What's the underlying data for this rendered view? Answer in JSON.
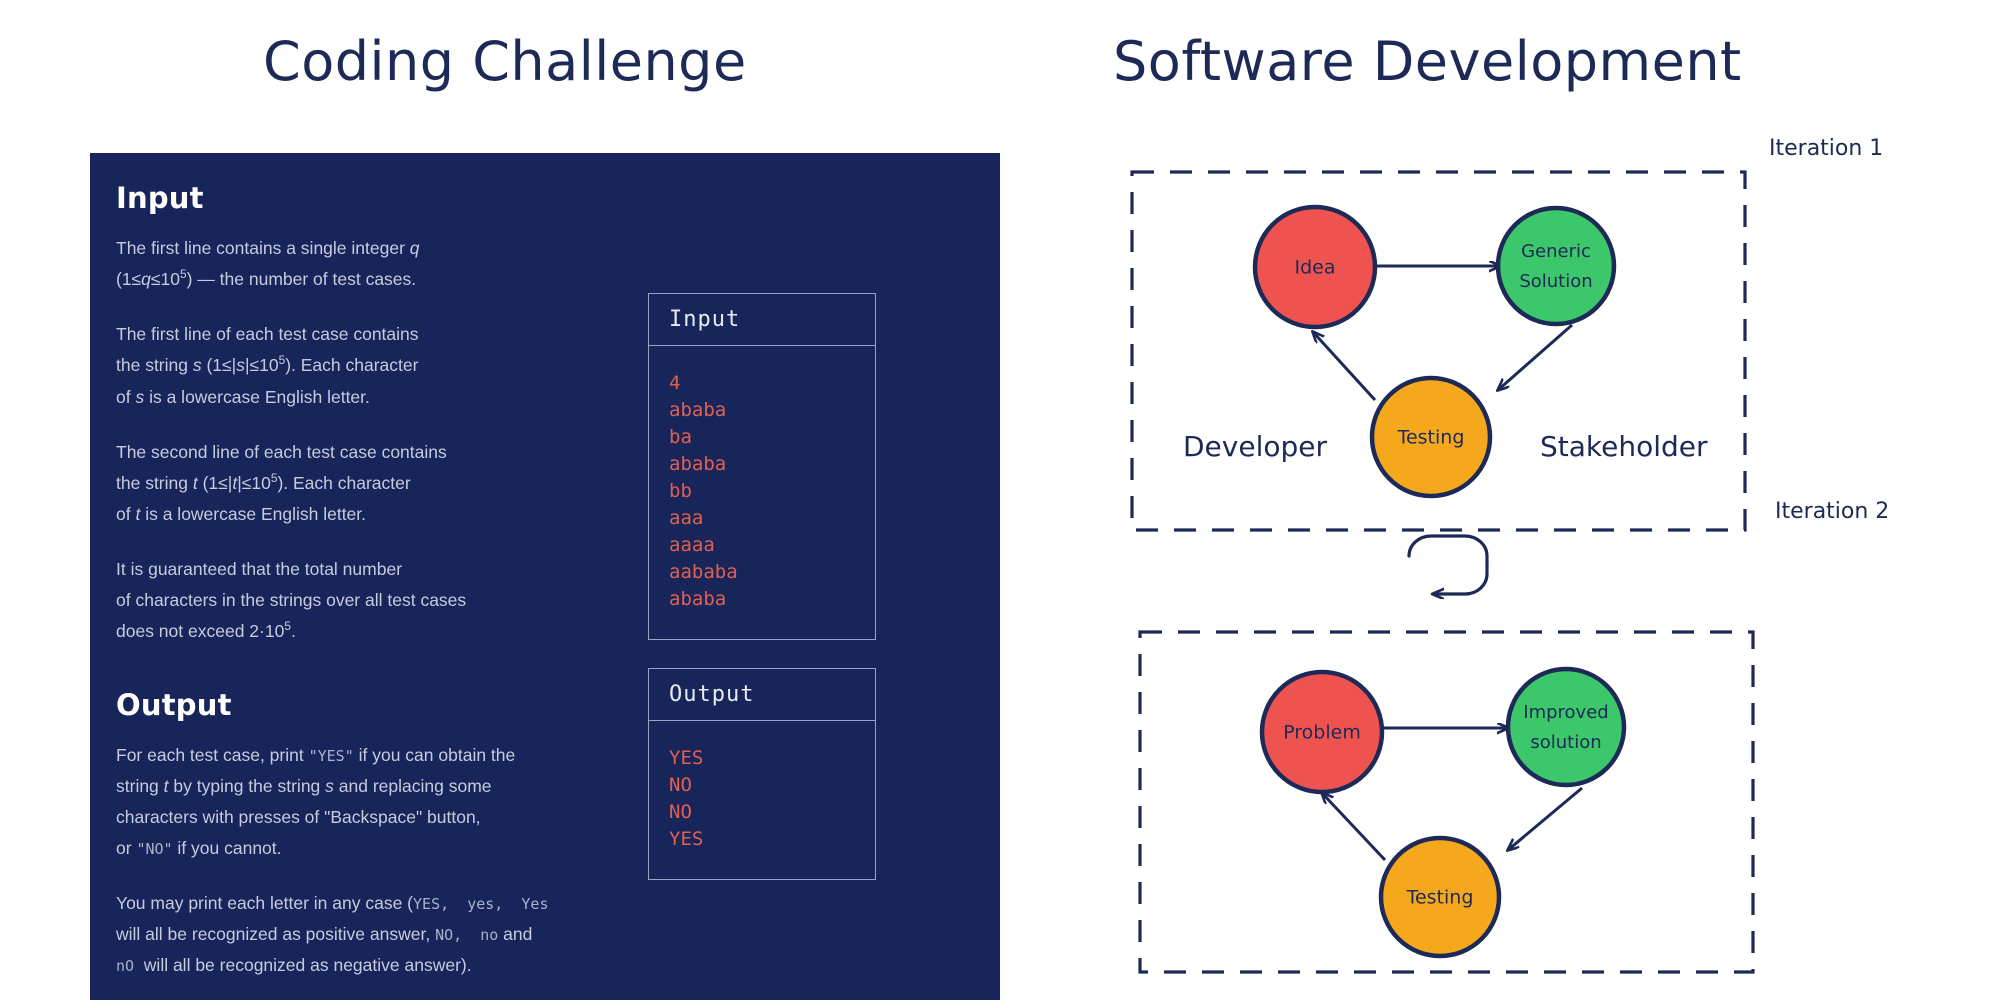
{
  "titles": {
    "left": "Coding Challenge",
    "right": "Software Development"
  },
  "problem": {
    "input_heading": "Input",
    "output_heading": "Output",
    "input_paragraphs": [
      "The first line contains a single integer q (1≤q≤10⁵) — the number of test cases.",
      "The first line of each test case contains the string s (1≤|s|≤10⁵). Each character of s is a lowercase English letter.",
      "The second line of each test case contains the string t (1≤|t|≤10⁵). Each character of t is a lowercase English letter.",
      "It is guaranteed that the total number of characters in the strings over all test cases does not exceed 2·10⁵."
    ],
    "output_paragraphs": [
      "For each test case, print \"YES\" if you can obtain the string t by typing the string s and replacing some characters with presses of \"Backspace\" button, or \"NO\" if you cannot.",
      "You may print each letter in any case (YES, yes, Yes will all be recognized as positive answer, NO, no and nO will all be recognized as negative answer)."
    ]
  },
  "samples": {
    "input": {
      "header": "Input",
      "lines": [
        "4",
        "ababa",
        "ba",
        "ababa",
        "bb",
        "aaa",
        "aaaa",
        "aababa",
        "ababa"
      ]
    },
    "output": {
      "header": "Output",
      "lines": [
        "YES",
        "NO",
        "NO",
        "YES"
      ]
    }
  },
  "diagram": {
    "iteration_1": {
      "label": "Iteration 1",
      "nodes": [
        {
          "id": "idea",
          "label": "Idea",
          "color": "#ef5350"
        },
        {
          "id": "generic",
          "label_line_1": "Generic",
          "label_line_2": "Solution",
          "color": "#3cc76a"
        },
        {
          "id": "testing1",
          "label": "Testing",
          "color": "#f5a81c"
        }
      ]
    },
    "iteration_2": {
      "label": "Iteration 2",
      "nodes": [
        {
          "id": "problem",
          "label": "Problem",
          "color": "#ef5350"
        },
        {
          "id": "improved",
          "label_line_1": "Improved",
          "label_line_2": "solution",
          "color": "#3cc76a"
        },
        {
          "id": "testing2",
          "label": "Testing",
          "color": "#f5a81c"
        }
      ]
    },
    "middle": {
      "developer": "Developer",
      "stakeholder": "Stakeholder"
    }
  },
  "colors": {
    "card_background": "#18255a",
    "ink": "#1d2a57",
    "red_node": "#ef5350",
    "green_node": "#3cc76a",
    "amber_node": "#f5a81c",
    "sample_text": "#e0604f"
  }
}
